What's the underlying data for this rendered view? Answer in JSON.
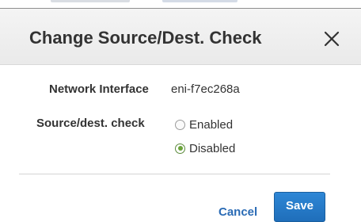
{
  "dialog": {
    "title": "Change Source/Dest. Check",
    "close_icon": "close-icon"
  },
  "fields": {
    "network_interface": {
      "label": "Network Interface",
      "value": "eni-f7ec268a"
    },
    "source_dest_check": {
      "label": "Source/dest. check",
      "options": [
        {
          "label": "Enabled",
          "selected": false
        },
        {
          "label": "Disabled",
          "selected": true
        }
      ]
    }
  },
  "footer": {
    "cancel_label": "Cancel",
    "save_label": "Save"
  },
  "colors": {
    "primary_button": "#2576c6",
    "link": "#2a6bb5",
    "radio_selected": "#6ba43a"
  }
}
